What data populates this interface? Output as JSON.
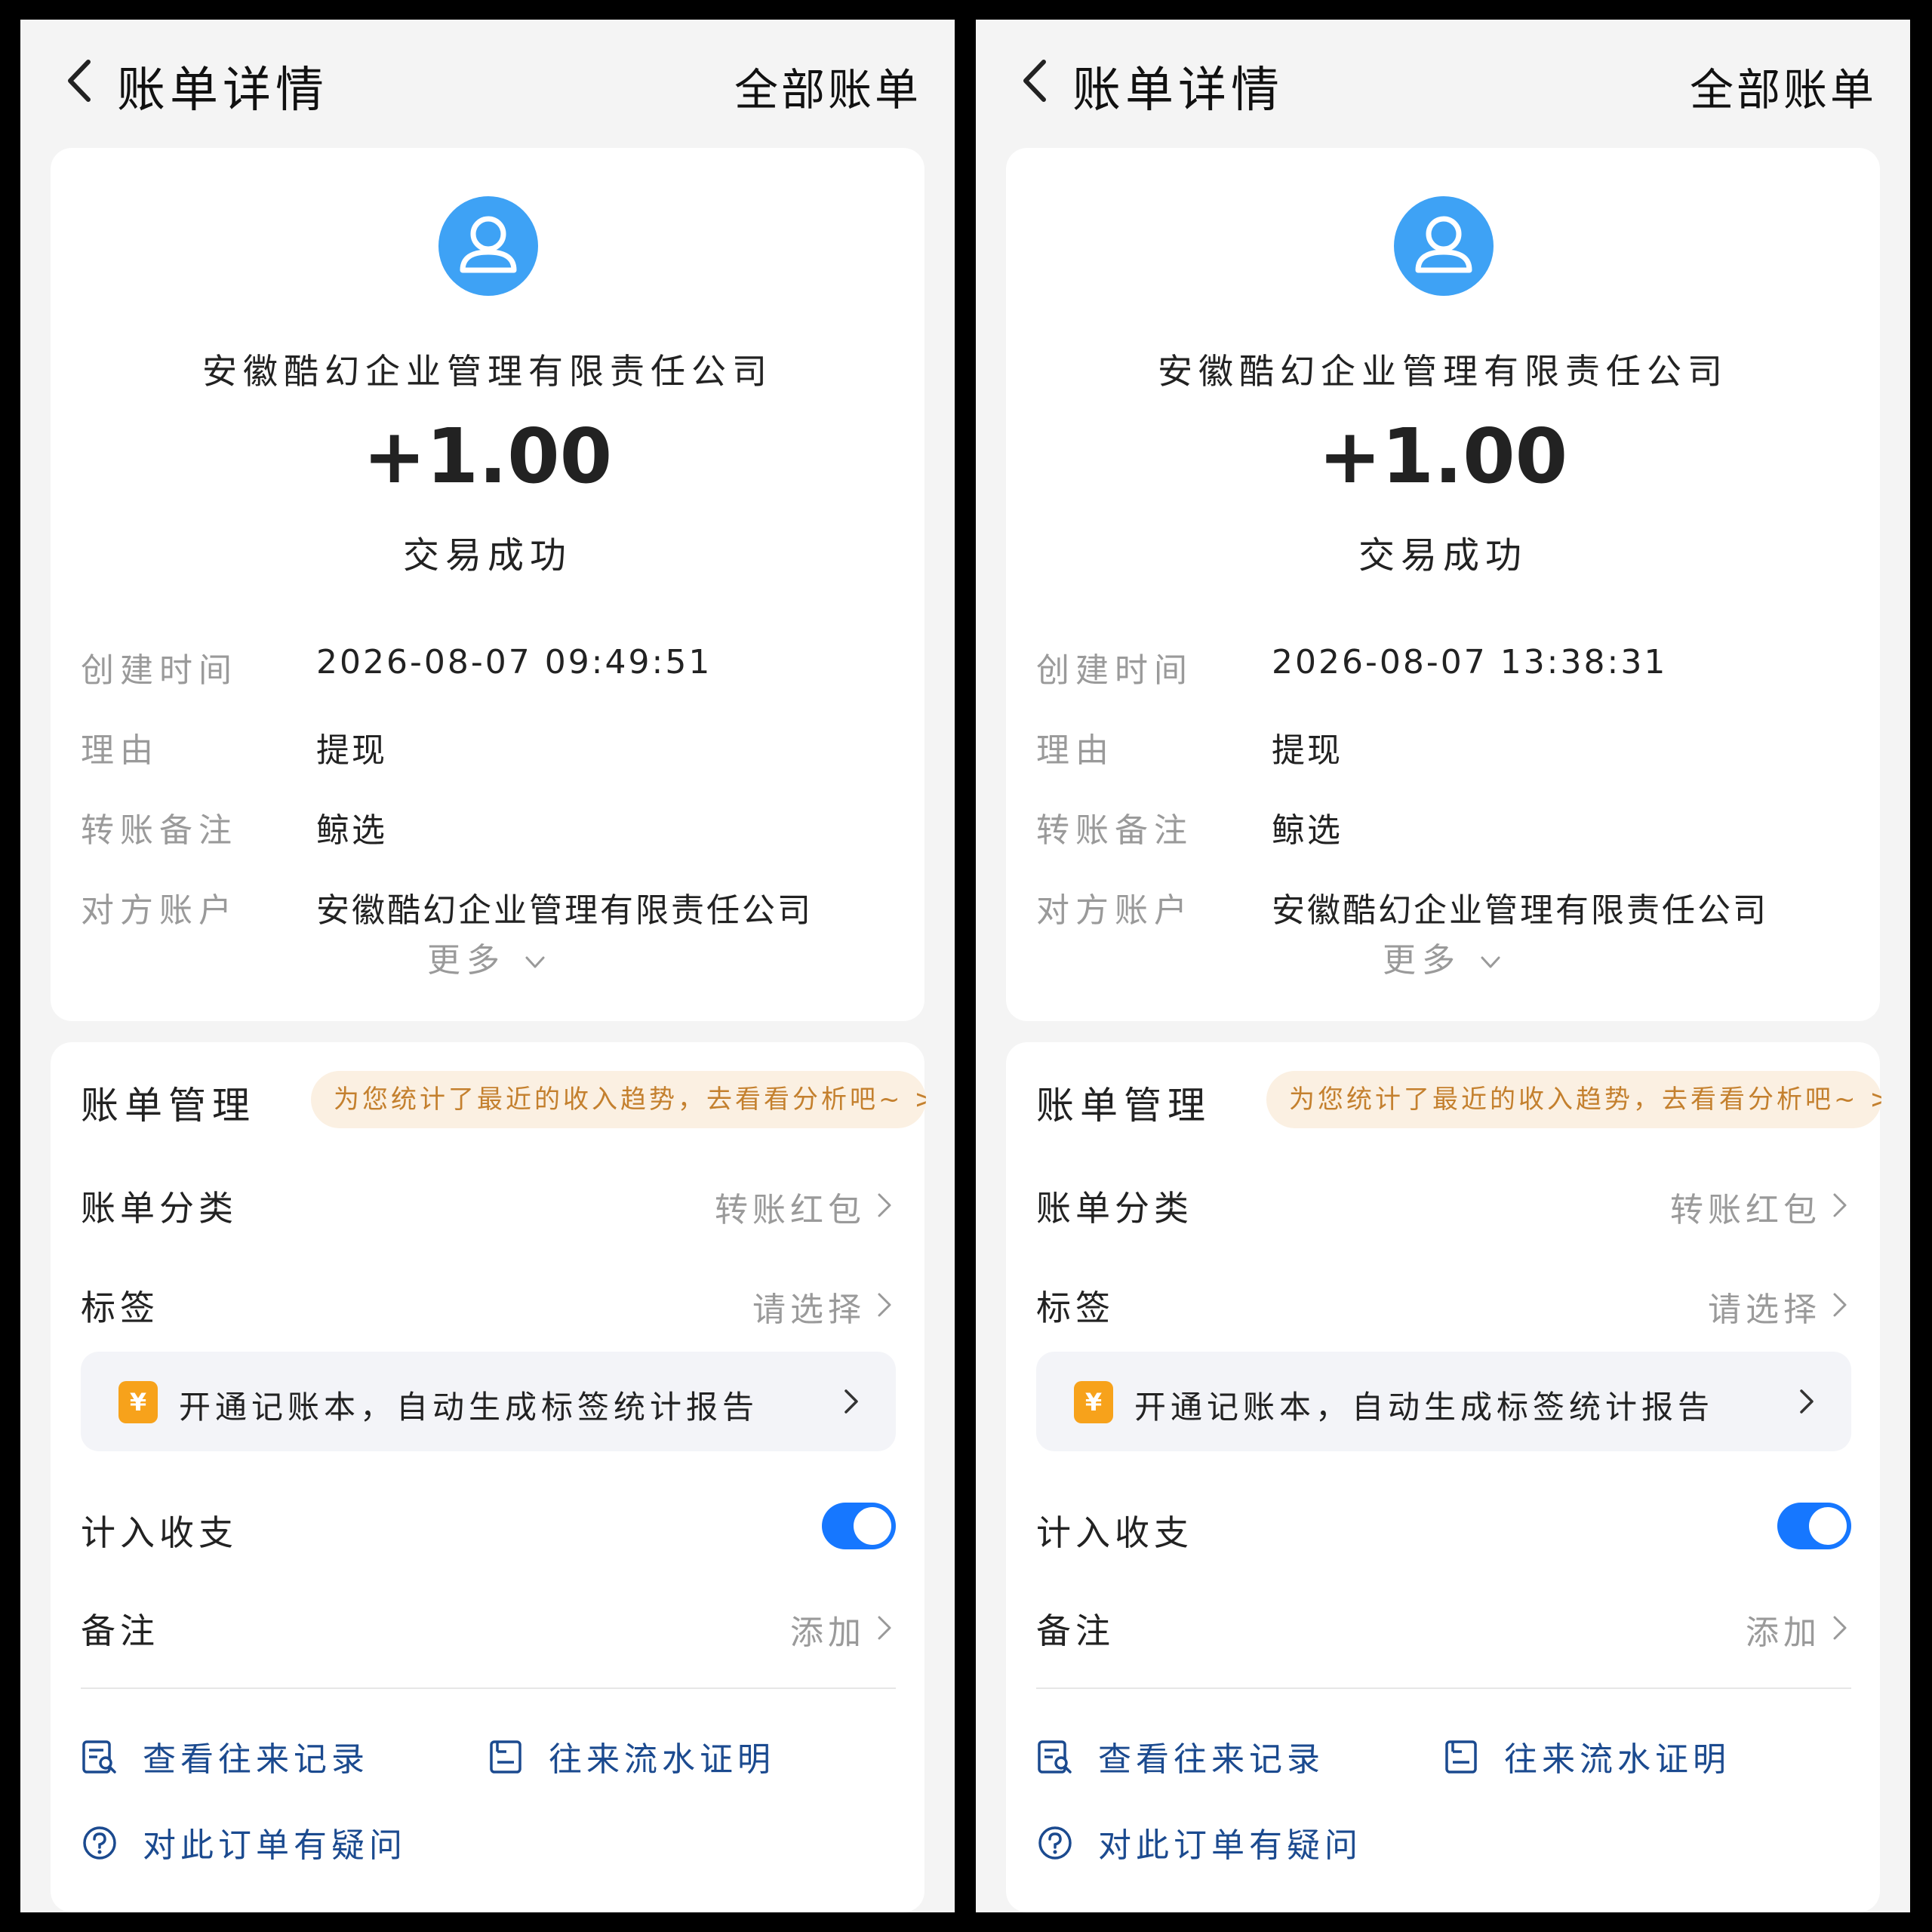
{
  "screens": [
    {
      "nav": {
        "title": "账单详情",
        "action": "全部账单"
      },
      "payee": "安徽酷幻企业管理有限责任公司",
      "amount": "+1.00",
      "status": "交易成功",
      "details": [
        {
          "label": "创建时间",
          "value": "2026-08-07 09:49:51"
        },
        {
          "label": "理由",
          "value": "提现"
        },
        {
          "label": "转账备注",
          "value": "鲸选"
        },
        {
          "label": "对方账户",
          "value": "安徽酷幻企业管理有限责任公司"
        }
      ],
      "more_label": "更多",
      "management": {
        "title": "账单管理",
        "tip": "为您统计了最近的收入趋势，去看看分析吧~",
        "category": {
          "label": "账单分类",
          "value": "转账红包"
        },
        "tags": {
          "label": "标签",
          "value": "请选择"
        },
        "promo": {
          "icon_text": "¥",
          "text": "开通记账本，自动生成标签统计报告"
        },
        "include": {
          "label": "计入收支",
          "enabled": true
        },
        "note": {
          "label": "备注",
          "value": "添加"
        },
        "links": {
          "records": "查看往来记录",
          "proof": "往来流水证明",
          "question": "对此订单有疑问"
        }
      }
    },
    {
      "nav": {
        "title": "账单详情",
        "action": "全部账单"
      },
      "payee": "安徽酷幻企业管理有限责任公司",
      "amount": "+1.00",
      "status": "交易成功",
      "details": [
        {
          "label": "创建时间",
          "value": "2026-08-07 13:38:31"
        },
        {
          "label": "理由",
          "value": "提现"
        },
        {
          "label": "转账备注",
          "value": "鲸选"
        },
        {
          "label": "对方账户",
          "value": "安徽酷幻企业管理有限责任公司"
        }
      ],
      "more_label": "更多",
      "management": {
        "title": "账单管理",
        "tip": "为您统计了最近的收入趋势，去看看分析吧~",
        "category": {
          "label": "账单分类",
          "value": "转账红包"
        },
        "tags": {
          "label": "标签",
          "value": "请选择"
        },
        "promo": {
          "icon_text": "¥",
          "text": "开通记账本，自动生成标签统计报告"
        },
        "include": {
          "label": "计入收支",
          "enabled": true
        },
        "note": {
          "label": "备注",
          "value": "添加"
        },
        "links": {
          "records": "查看往来记录",
          "proof": "往来流水证明",
          "question": "对此订单有疑问"
        }
      }
    }
  ],
  "colors": {
    "accent": "#1677ff",
    "avatar": "#3ea2f5",
    "tip_bg": "#fbf0e2",
    "tip_text": "#c4802e",
    "link": "#1b4a8f",
    "promo_icon": "#f7a21b"
  }
}
